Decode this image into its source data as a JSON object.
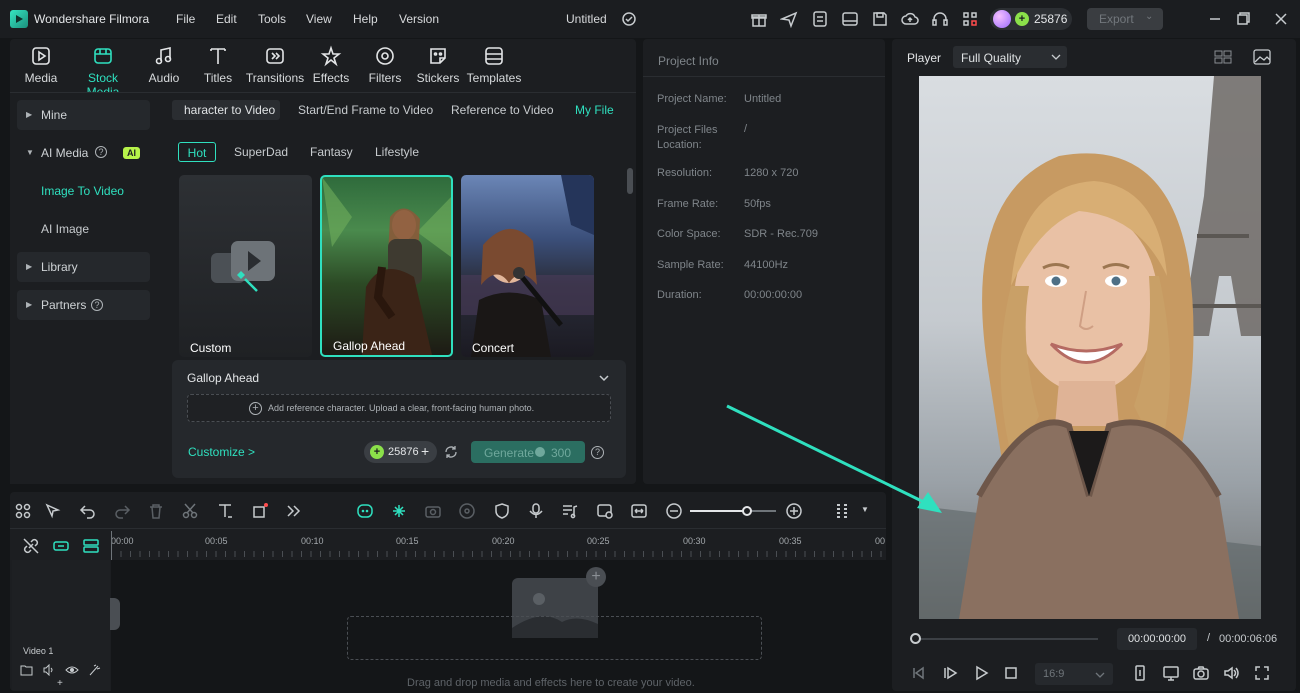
{
  "app": {
    "name": "Wondershare Filmora",
    "project_title": "Untitled",
    "credits": "25876",
    "export_label": "Export"
  },
  "menu": [
    "File",
    "Edit",
    "Tools",
    "View",
    "Help",
    "Version"
  ],
  "toolbar": [
    {
      "label": "Media",
      "icon": "media-icon"
    },
    {
      "label": "Stock Media",
      "icon": "stock-media-icon"
    },
    {
      "label": "Audio",
      "icon": "audio-icon"
    },
    {
      "label": "Titles",
      "icon": "titles-icon"
    },
    {
      "label": "Transitions",
      "icon": "transitions-icon"
    },
    {
      "label": "Effects",
      "icon": "effects-icon"
    },
    {
      "label": "Filters",
      "icon": "filters-icon"
    },
    {
      "label": "Stickers",
      "icon": "stickers-icon"
    },
    {
      "label": "Templates",
      "icon": "templates-icon"
    }
  ],
  "sidebar": {
    "mine": "Mine",
    "ai_media": "AI Media",
    "ai_badge": "AI",
    "image_to_video": "Image To Video",
    "ai_image": "AI Image",
    "library": "Library",
    "partners": "Partners"
  },
  "subtabs": [
    "haracter to Video",
    "Start/End Frame to Video",
    "Reference to Video",
    "My File"
  ],
  "chips": [
    "Hot",
    "SuperDad",
    "Fantasy",
    "Lifestyle"
  ],
  "cards": [
    "Custom",
    "Gallop Ahead",
    "Concert"
  ],
  "generator": {
    "template": "Gallop Ahead",
    "upload_hint": "Add reference character. Upload a clear, front-facing human photo.",
    "customize": "Customize >",
    "credits": "25876",
    "generate": "Generate",
    "cost": "300"
  },
  "project_info": {
    "header": "Project Info",
    "rows": [
      {
        "label": "Project Name:",
        "value": "Untitled"
      },
      {
        "label": "Project Files Location:",
        "value": "/"
      },
      {
        "label": "Resolution:",
        "value": "1280 x 720"
      },
      {
        "label": "Frame Rate:",
        "value": "50fps"
      },
      {
        "label": "Color Space:",
        "value": "SDR - Rec.709"
      },
      {
        "label": "Sample Rate:",
        "value": "44100Hz"
      },
      {
        "label": "Duration:",
        "value": "00:00:00:00"
      }
    ]
  },
  "player": {
    "label": "Player",
    "quality": "Full Quality",
    "current_time": "00:00:00:00",
    "separator": "/",
    "total_time": "00:00:06:06",
    "aspect": "16:9",
    "progress": 0
  },
  "timeline": {
    "ticks": [
      "00:00",
      "00:05",
      "00:10",
      "00:15",
      "00:20",
      "00:25",
      "00:30",
      "00:35",
      "00"
    ],
    "track_label": "Video 1",
    "drop_hint": "Drag and drop media and effects here to create your video.",
    "zoom_level": 0.66
  },
  "colors": {
    "accent": "#2fe0bf",
    "background": "#141618",
    "panel": "#1c1e21"
  }
}
